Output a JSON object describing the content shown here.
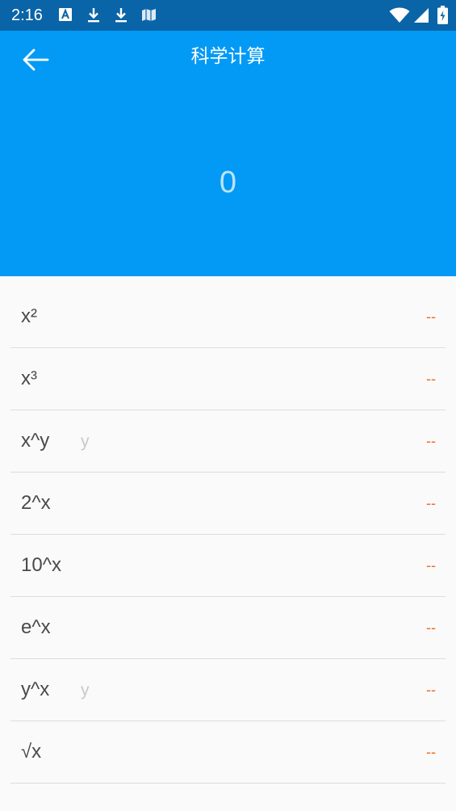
{
  "status_bar": {
    "time": "2:16",
    "icons": [
      "text-a-icon",
      "download-icon",
      "download-icon",
      "map-icon",
      "wifi-icon",
      "cell-signal-icon",
      "battery-icon"
    ]
  },
  "header": {
    "title": "科学计算",
    "back_icon": "arrow-left-icon"
  },
  "display": {
    "value": "0"
  },
  "functions": [
    {
      "label": "x²",
      "param_placeholder": "",
      "result": "--"
    },
    {
      "label": "x³",
      "param_placeholder": "",
      "result": "--"
    },
    {
      "label": "x^y",
      "param_placeholder": "y",
      "result": "--"
    },
    {
      "label": "2^x",
      "param_placeholder": "",
      "result": "--"
    },
    {
      "label": "10^x",
      "param_placeholder": "",
      "result": "--"
    },
    {
      "label": "e^x",
      "param_placeholder": "",
      "result": "--"
    },
    {
      "label": "y^x",
      "param_placeholder": "y",
      "result": "--"
    },
    {
      "label": "√x",
      "param_placeholder": "",
      "result": "--"
    }
  ],
  "colors": {
    "status_bar": "#0a64a8",
    "app_bar": "#039af5",
    "result_accent": "#f06a1d",
    "background": "#fafafa"
  }
}
